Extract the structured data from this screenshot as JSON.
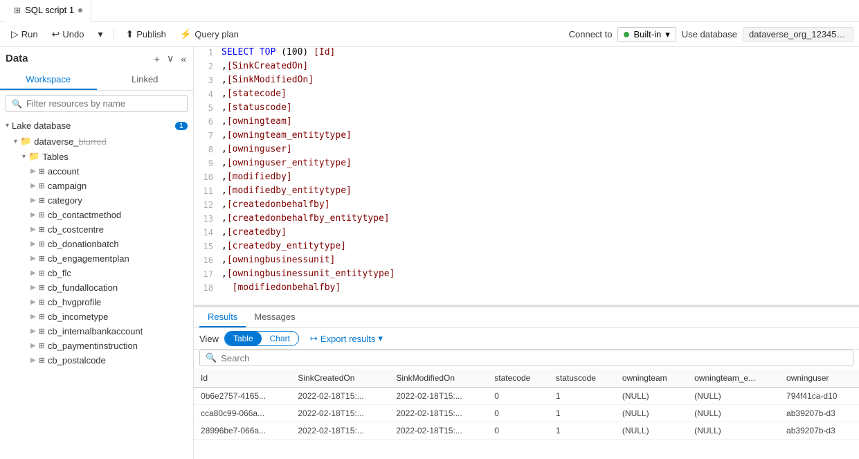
{
  "topbar": {
    "tab_icon": "⊞",
    "tab_label": "SQL script 1",
    "tab_dot": true
  },
  "toolbar": {
    "run_label": "Run",
    "undo_label": "Undo",
    "dropdown_label": "",
    "publish_label": "Publish",
    "query_plan_label": "Query plan",
    "connect_to_label": "Connect to",
    "built_in_label": "Built-in",
    "use_database_label": "Use database",
    "database_value": "dataverse_org_12345abc..."
  },
  "sidebar": {
    "title": "Data",
    "add_icon": "+",
    "down_icon": "∨",
    "collapse_icon": "«",
    "tab_workspace": "Workspace",
    "tab_linked": "Linked",
    "search_placeholder": "Filter resources by name",
    "section_label": "Lake database",
    "section_badge": "1",
    "dataverse_label": "dataverse_...",
    "tables_label": "Tables",
    "tables": [
      "account",
      "campaign",
      "category",
      "cb_contactmethod",
      "cb_costcentre",
      "cb_donationbatch",
      "cb_engagementplan",
      "cb_flc",
      "cb_fundallocation",
      "cb_hvgprofile",
      "cb_incometype",
      "cb_internalbankaccount",
      "cb_paymentinstruction",
      "cb_postalcode"
    ]
  },
  "editor": {
    "lines": [
      {
        "num": 1,
        "text": "SELECT TOP (100) [Id]",
        "highlight": "SELECT TOP (100) [Id]"
      },
      {
        "num": 2,
        "text": ",[SinkCreatedOn]"
      },
      {
        "num": 3,
        "text": ",[SinkModifiedOn]"
      },
      {
        "num": 4,
        "text": ",[statecode]"
      },
      {
        "num": 5,
        "text": ",[statuscode]"
      },
      {
        "num": 6,
        "text": ",[owningteam]"
      },
      {
        "num": 7,
        "text": ",[owningteam_entitytype]"
      },
      {
        "num": 8,
        "text": ",[owninguser]"
      },
      {
        "num": 9,
        "text": ",[owninguser_entitytype]"
      },
      {
        "num": 10,
        "text": ",[modifiedby]"
      },
      {
        "num": 11,
        "text": ",[modifiedby_entitytype]"
      },
      {
        "num": 12,
        "text": ",[createdonbehalfby]"
      },
      {
        "num": 13,
        "text": ",[createdonbehalfby_entitytype]"
      },
      {
        "num": 14,
        "text": ",[createdby]"
      },
      {
        "num": 15,
        "text": ",[createdby_entitytype]"
      },
      {
        "num": 16,
        "text": ",[owningbusinessunit]"
      },
      {
        "num": 17,
        "text": ",[owningbusinessunit_entitytype]"
      },
      {
        "num": 18,
        "text": "  [modifiedonbehalfby]"
      }
    ]
  },
  "results": {
    "tab_results": "Results",
    "tab_messages": "Messages",
    "view_label": "View",
    "view_table": "Table",
    "view_chart": "Chart",
    "export_label": "Export results",
    "search_placeholder": "Search",
    "columns": [
      "Id",
      "SinkCreatedOn",
      "SinkModifiedOn",
      "statecode",
      "statuscode",
      "owningteam",
      "owningteam_e...",
      "owninguser"
    ],
    "rows": [
      [
        "0b6e2757-4165...",
        "2022-02-18T15:...",
        "2022-02-18T15:...",
        "0",
        "1",
        "(NULL)",
        "(NULL)",
        "794f41ca-d10"
      ],
      [
        "cca80c99-066a...",
        "2022-02-18T15:...",
        "2022-02-18T15:...",
        "0",
        "1",
        "(NULL)",
        "(NULL)",
        "ab39207b-d3"
      ],
      [
        "28996be7-066a...",
        "2022-02-18T15:...",
        "2022-02-18T15:...",
        "0",
        "1",
        "(NULL)",
        "(NULL)",
        "ab39207b-d3"
      ]
    ]
  }
}
